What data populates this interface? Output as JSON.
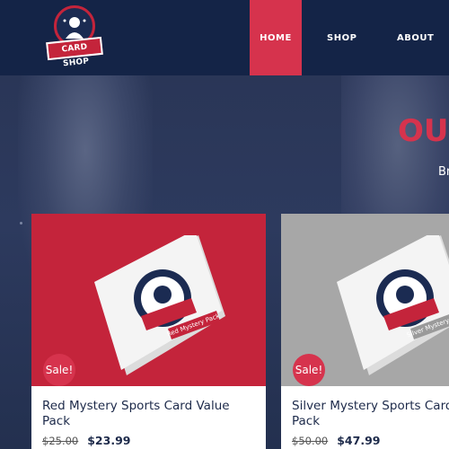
{
  "brand": {
    "logo_text": "CARD SHOP"
  },
  "nav": {
    "items": [
      {
        "label": "HOME"
      },
      {
        "label": "SHOP"
      },
      {
        "label": "ABOUT"
      }
    ]
  },
  "hero": {
    "title": "OU",
    "subtitle": "Br"
  },
  "products": [
    {
      "name": "Red Mystery Sports Card Value Pack",
      "pack_label": "Red Mystery Pack",
      "badge": "Sale!",
      "old_price": "$25.00",
      "price": "$23.99"
    },
    {
      "name": "Silver Mystery Sports Card Value Pack",
      "pack_label": "Silver Mystery Pack",
      "badge": "Sale!",
      "old_price": "$50.00",
      "price": "$47.99"
    }
  ],
  "colors": {
    "header_bg": "#142447",
    "accent": "#d6334d",
    "red_card_bg": "#c4243b",
    "silver_card_bg": "#a7a7a7",
    "text_dark": "#1d2a4a"
  }
}
